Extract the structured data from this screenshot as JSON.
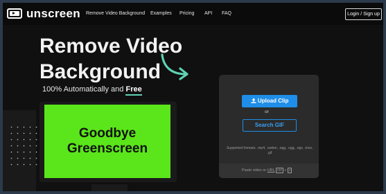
{
  "nav": {
    "brand": "unscreen",
    "logo_icon": "play-screen-icon",
    "links": [
      "Remove Video Background",
      "Examples",
      "Pricing",
      "API",
      "FAQ"
    ],
    "login": "Login / Sign up"
  },
  "hero": {
    "title_line1": "Remove Video",
    "title_line2": "Background",
    "subtitle_prefix": "100% Automatically and ",
    "subtitle_free": "Free",
    "arrow_icon": "curved-arrow-icon",
    "preview_line1": "Goodbye",
    "preview_line2": "Greenscreen"
  },
  "upload": {
    "upload_label": "Upload Clip",
    "upload_icon": "upload-icon",
    "or": "or",
    "search_label": "Search GIF",
    "formats": "Supported formats: .mp4, .webm, .ogg, .ogg, .ogv, .mov, .gif",
    "paste_prefix": "Paste video or ",
    "paste_url": "URL",
    "key_ctrl": "ctrl",
    "key_plus": "+",
    "key_v": "v"
  },
  "colors": {
    "accent_blue": "#1f8ee8",
    "accent_teal": "#5fd3b3",
    "green_screen": "#5ae61a"
  }
}
